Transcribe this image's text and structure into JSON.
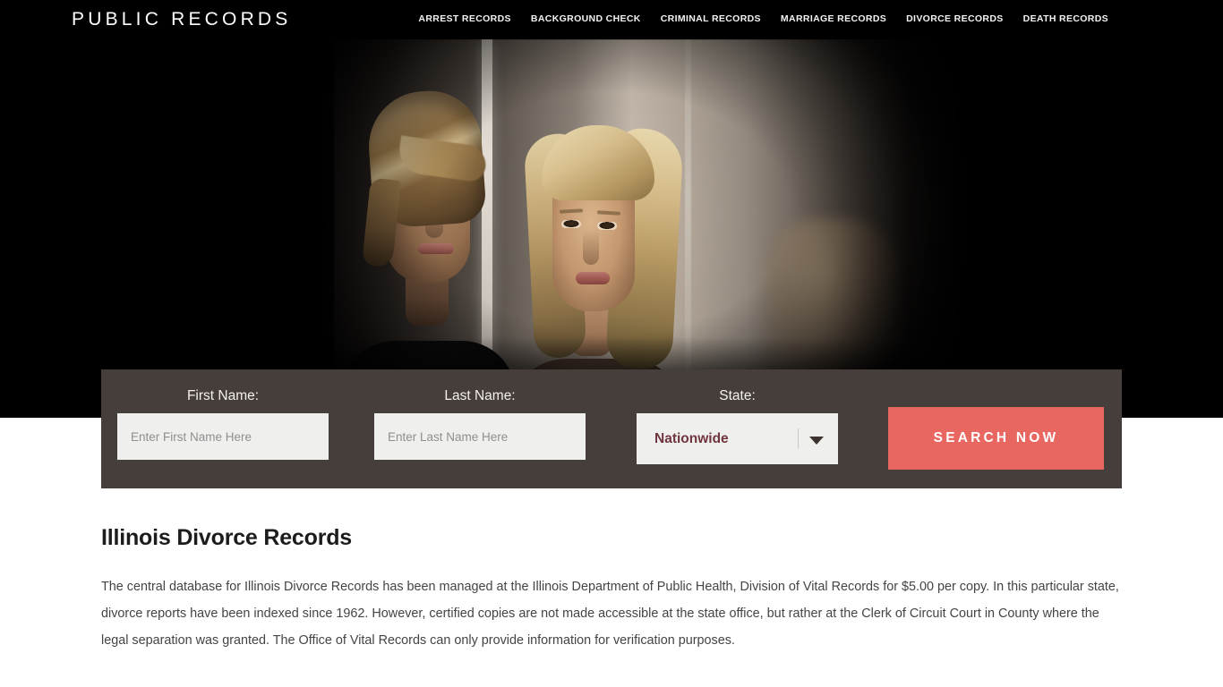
{
  "header": {
    "brand": "PUBLIC RECORDS",
    "nav": [
      {
        "label": "ARREST RECORDS",
        "name": "nav-arrest-records"
      },
      {
        "label": "BACKGROUND CHECK",
        "name": "nav-background-check"
      },
      {
        "label": "CRIMINAL RECORDS",
        "name": "nav-criminal-records"
      },
      {
        "label": "MARRIAGE RECORDS",
        "name": "nav-marriage-records"
      },
      {
        "label": "DIVORCE RECORDS",
        "name": "nav-divorce-records"
      },
      {
        "label": "DEATH RECORDS",
        "name": "nav-death-records"
      }
    ]
  },
  "hero": {
    "image_description": "Blurred photo of a man and a woman leaning on opposite sides of a bright wall divider, dark vignette"
  },
  "search": {
    "first_name": {
      "label": "First Name:",
      "placeholder": "Enter First Name Here",
      "value": ""
    },
    "last_name": {
      "label": "Last Name:",
      "placeholder": "Enter Last Name Here",
      "value": ""
    },
    "state": {
      "label": "State:",
      "selected": "Nationwide"
    },
    "submit_label": "SEARCH NOW",
    "accent_color": "#e86761",
    "panel_color": "#463e3b"
  },
  "article": {
    "title": "Illinois Divorce Records",
    "paragraph_1": "The central database for Illinois Divorce Records has been managed at the Illinois Department of Public Health, Division of Vital Records for $5.00 per copy. In this particular state, divorce reports have been indexed since 1962. However, certified copies are not made accessible at the state office, but rather at the Clerk of Circuit Court in County where the legal separation was granted. The Office of Vital Records can only provide information for verification purposes."
  }
}
